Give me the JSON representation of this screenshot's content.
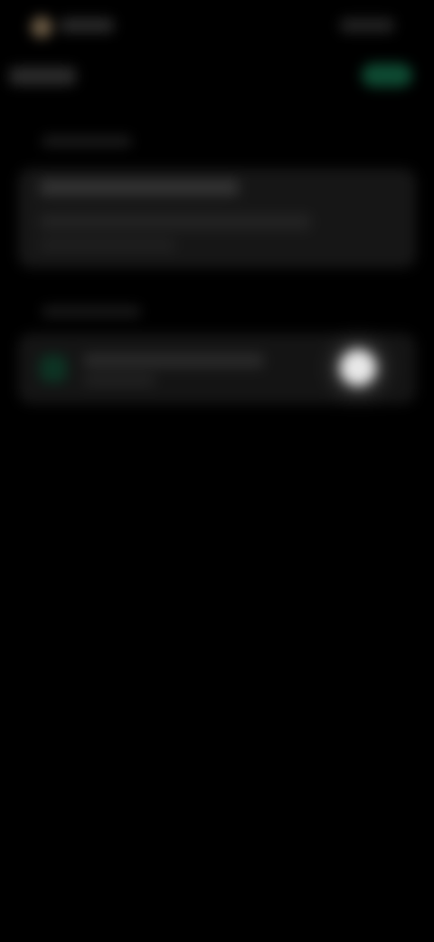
{
  "icons": {
    "status": "status-dot-icon",
    "section": "setting-icon"
  },
  "colors": {
    "background": "#000000",
    "card": "#161616",
    "accent_green": "#0e4a32",
    "knob": "#e8e8e8"
  }
}
